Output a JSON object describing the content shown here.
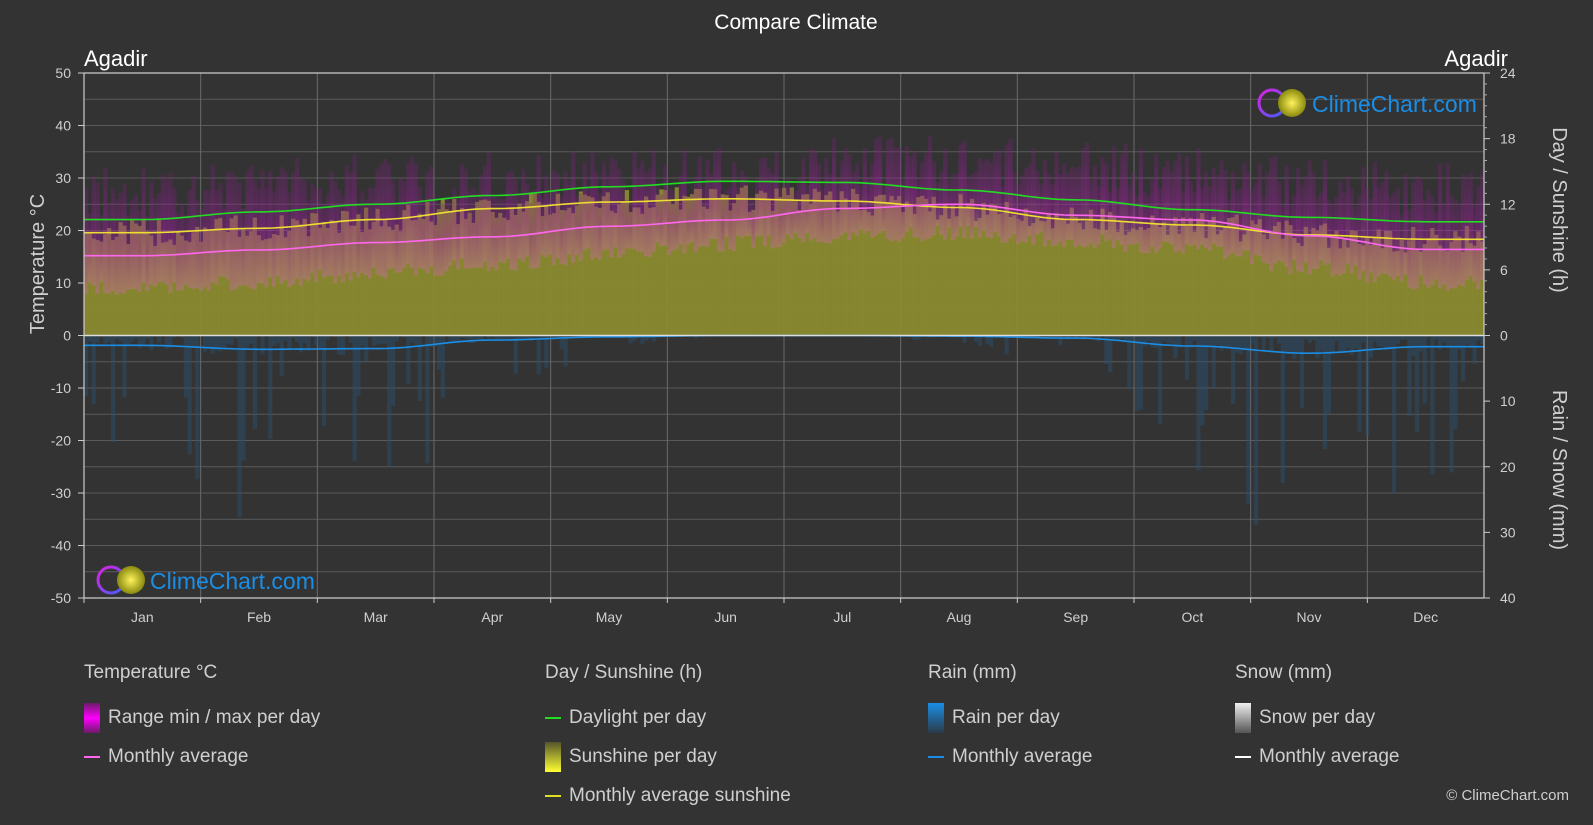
{
  "chart_data": {
    "type": "area",
    "title": "Compare Climate",
    "location_left": "Agadir",
    "location_right": "Agadir",
    "watermark": "ClimeChart.com",
    "copyright": "© ClimeChart.com",
    "categories": [
      "Jan",
      "Feb",
      "Mar",
      "Apr",
      "May",
      "Jun",
      "Jul",
      "Aug",
      "Sep",
      "Oct",
      "Nov",
      "Dec"
    ],
    "axes": {
      "left": {
        "label": "Temperature °C",
        "range": [
          -50,
          50
        ],
        "ticks": [
          50,
          40,
          30,
          20,
          10,
          0,
          -10,
          -20,
          -30,
          -40,
          -50
        ]
      },
      "right_top": {
        "label": "Day / Sunshine (h)",
        "range": [
          0,
          24
        ],
        "ticks": [
          24,
          18,
          12,
          6,
          0
        ]
      },
      "right_bottom": {
        "label": "Rain / Snow (mm)",
        "range": [
          0,
          40
        ],
        "ticks": [
          0,
          10,
          20,
          30,
          40
        ]
      }
    },
    "grid": true,
    "series": [
      {
        "name": "Daylight per day",
        "unit": "h",
        "color": "#22dd22",
        "values": [
          10.6,
          11.3,
          12.0,
          12.8,
          13.6,
          14.1,
          14.0,
          13.3,
          12.4,
          11.5,
          10.8,
          10.4
        ]
      },
      {
        "name": "Monthly average sunshine",
        "unit": "h",
        "color": "#eedd33",
        "values": [
          9.4,
          9.8,
          10.6,
          11.6,
          12.2,
          12.5,
          12.3,
          11.7,
          10.6,
          10.1,
          9.2,
          8.8
        ]
      },
      {
        "name": "Temperature monthly average",
        "unit": "°C",
        "color": "#ff66ee",
        "values": [
          15.2,
          16.3,
          17.7,
          18.8,
          20.8,
          22.0,
          24.2,
          25.0,
          22.9,
          22.0,
          19.0,
          16.4
        ]
      },
      {
        "name": "Temperature range max (approx)",
        "unit": "°C",
        "color": "#cc00cc",
        "values": [
          25.5,
          27,
          28,
          28,
          28.5,
          29,
          31,
          32,
          30,
          29,
          27,
          26
        ]
      },
      {
        "name": "Temperature range min (approx)",
        "unit": "°C",
        "color": "#cc00cc",
        "values": [
          9,
          10,
          12,
          13.5,
          15.5,
          17.5,
          19,
          19.5,
          18,
          16.5,
          13,
          10
        ]
      },
      {
        "name": "Rain monthly average",
        "unit": "mm",
        "color": "#1a8ee6",
        "values": [
          1.5,
          2.1,
          2.0,
          0.7,
          0.2,
          0.0,
          0.0,
          0.1,
          0.4,
          1.6,
          2.7,
          1.7
        ]
      },
      {
        "name": "Snow monthly average",
        "unit": "mm",
        "color": "#ffffff",
        "values": [
          0,
          0,
          0,
          0,
          0,
          0,
          0,
          0,
          0,
          0,
          0,
          0
        ]
      }
    ]
  },
  "legend": {
    "groups": [
      {
        "title": "Temperature °C",
        "items": [
          {
            "label": "Range min / max per day",
            "kind": "box",
            "color": "#e000e0"
          },
          {
            "label": "Monthly average",
            "kind": "line",
            "color": "#ff66ee"
          }
        ]
      },
      {
        "title": "Day / Sunshine (h)",
        "items": [
          {
            "label": "Daylight per day",
            "kind": "line",
            "color": "#22dd22"
          },
          {
            "label": "Sunshine per day",
            "kind": "box",
            "color": "#eeee33"
          },
          {
            "label": "Monthly average sunshine",
            "kind": "line",
            "color": "#dddd22"
          }
        ]
      },
      {
        "title": "Rain (mm)",
        "items": [
          {
            "label": "Rain per day",
            "kind": "box",
            "color": "#1a8ee6"
          },
          {
            "label": "Monthly average",
            "kind": "line",
            "color": "#1a8ee6"
          }
        ]
      },
      {
        "title": "Snow (mm)",
        "items": [
          {
            "label": "Snow per day",
            "kind": "box",
            "color": "#dddddd"
          },
          {
            "label": "Monthly average",
            "kind": "line",
            "color": "#ffffff"
          }
        ]
      }
    ]
  }
}
